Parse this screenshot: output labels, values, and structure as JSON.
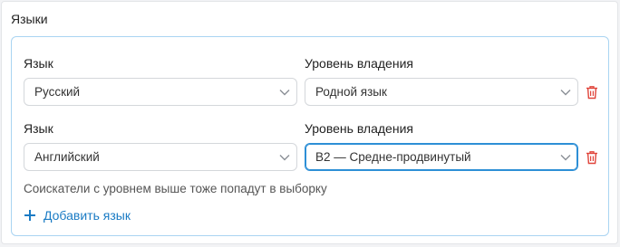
{
  "section": {
    "title": "Языки"
  },
  "rows": [
    {
      "language_label": "Язык",
      "language_value": "Русский",
      "level_label": "Уровень владения",
      "level_value": "Родной язык"
    },
    {
      "language_label": "Язык",
      "language_value": "Английский",
      "level_label": "Уровень владения",
      "level_value": "B2 — Средне-продвинутый"
    }
  ],
  "hint": "Соискатели с уровнем выше тоже попадут в выборку",
  "add_button": {
    "label": "Добавить язык"
  },
  "colors": {
    "accent": "#1a7bc4",
    "focus_border": "#2d8fd6",
    "card_border": "#a9d4f2",
    "delete_icon": "#e0443a"
  }
}
